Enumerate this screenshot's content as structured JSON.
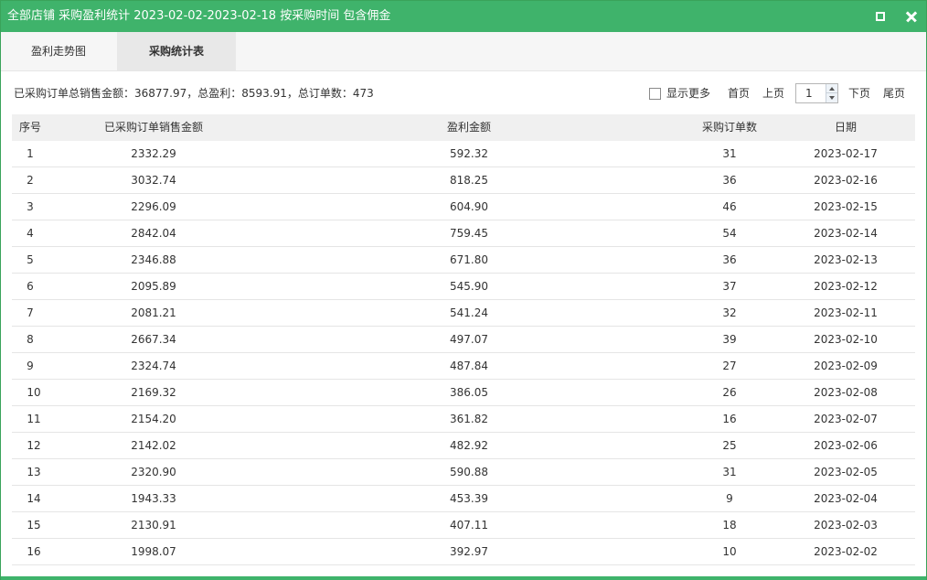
{
  "window": {
    "title": "全部店铺 采购盈利统计 2023-02-02-2023-02-18 按采购时间 包含佣金",
    "accent_color": "#3fb36b",
    "controls": {
      "maximize_icon": "maximize-icon",
      "close_icon": "close-icon"
    }
  },
  "tabs": [
    {
      "label": "盈利走势图",
      "active": false
    },
    {
      "label": "采购统计表",
      "active": true
    }
  ],
  "summary": "已采购订单总销售金额：36877.97，总盈利：8593.91，总订单数：473",
  "toolbar": {
    "show_more_label": "显示更多",
    "show_more_checked": false,
    "first_label": "首页",
    "prev_label": "上页",
    "page_value": "1",
    "next_label": "下页",
    "last_label": "尾页"
  },
  "table": {
    "columns": [
      "序号",
      "已采购订单销售金额",
      "盈利金额",
      "采购订单数",
      "日期"
    ],
    "rows": [
      [
        "1",
        "2332.29",
        "592.32",
        "31",
        "2023-02-17"
      ],
      [
        "2",
        "3032.74",
        "818.25",
        "36",
        "2023-02-16"
      ],
      [
        "3",
        "2296.09",
        "604.90",
        "46",
        "2023-02-15"
      ],
      [
        "4",
        "2842.04",
        "759.45",
        "54",
        "2023-02-14"
      ],
      [
        "5",
        "2346.88",
        "671.80",
        "36",
        "2023-02-13"
      ],
      [
        "6",
        "2095.89",
        "545.90",
        "37",
        "2023-02-12"
      ],
      [
        "7",
        "2081.21",
        "541.24",
        "32",
        "2023-02-11"
      ],
      [
        "8",
        "2667.34",
        "497.07",
        "39",
        "2023-02-10"
      ],
      [
        "9",
        "2324.74",
        "487.84",
        "27",
        "2023-02-09"
      ],
      [
        "10",
        "2169.32",
        "386.05",
        "26",
        "2023-02-08"
      ],
      [
        "11",
        "2154.20",
        "361.82",
        "16",
        "2023-02-07"
      ],
      [
        "12",
        "2142.02",
        "482.92",
        "25",
        "2023-02-06"
      ],
      [
        "13",
        "2320.90",
        "590.88",
        "31",
        "2023-02-05"
      ],
      [
        "14",
        "1943.33",
        "453.39",
        "9",
        "2023-02-04"
      ],
      [
        "15",
        "2130.91",
        "407.11",
        "18",
        "2023-02-03"
      ],
      [
        "16",
        "1998.07",
        "392.97",
        "10",
        "2023-02-02"
      ]
    ]
  }
}
